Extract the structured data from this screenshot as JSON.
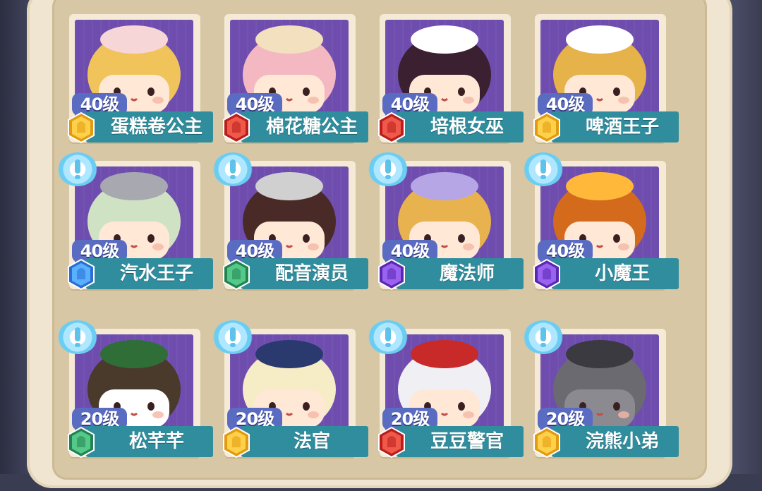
{
  "colors": {
    "portrait_bg": "#6e4dae",
    "name_bar": "#2f8d9e",
    "level_badge": "#5a6bc2",
    "rank_gold": "#f2b21c",
    "rank_red": "#d8322c",
    "rank_blue": "#3b8fe0",
    "rank_green": "#39a66a",
    "rank_purple": "#7a3fd1"
  },
  "cards": [
    {
      "level": "40级",
      "name": "蛋糕卷公主",
      "rank": "gold",
      "has_tip": false
    },
    {
      "level": "40级",
      "name": "棉花糖公主",
      "rank": "red",
      "has_tip": false
    },
    {
      "level": "40级",
      "name": "培根女巫",
      "rank": "red",
      "has_tip": false
    },
    {
      "level": "40级",
      "name": "啤酒王子",
      "rank": "gold",
      "has_tip": false
    },
    {
      "level": "40级",
      "name": "汽水王子",
      "rank": "blue",
      "has_tip": true
    },
    {
      "level": "40级",
      "name": "配音演员",
      "rank": "green",
      "has_tip": true
    },
    {
      "level": "40级",
      "name": "魔法师",
      "rank": "purple",
      "has_tip": true
    },
    {
      "level": "40级",
      "name": "小魔王",
      "rank": "purple",
      "has_tip": true
    },
    {
      "level": "20级",
      "name": "松芊芊",
      "rank": "green",
      "has_tip": true
    },
    {
      "level": "20级",
      "name": "法官",
      "rank": "gold",
      "has_tip": true
    },
    {
      "level": "20级",
      "name": "豆豆警官",
      "rank": "red",
      "has_tip": true
    },
    {
      "level": "20级",
      "name": "浣熊小弟",
      "rank": "gold",
      "has_tip": true
    }
  ]
}
